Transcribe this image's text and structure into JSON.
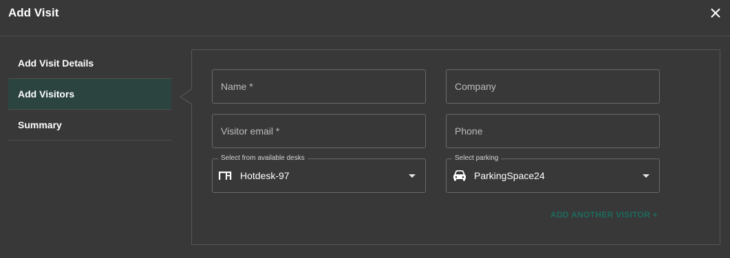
{
  "header": {
    "title": "Add Visit",
    "close_icon": "close-icon"
  },
  "sidebar": {
    "items": [
      {
        "label": "Add Visit Details",
        "active": false
      },
      {
        "label": "Add Visitors",
        "active": true
      },
      {
        "label": "Summary",
        "active": false
      }
    ]
  },
  "form": {
    "name": {
      "placeholder": "Name *"
    },
    "company": {
      "placeholder": "Company"
    },
    "visitor_email": {
      "placeholder": "Visitor email *"
    },
    "phone": {
      "placeholder": "Phone"
    },
    "desk": {
      "legend": "Select from available desks",
      "value": "Hotdesk-97",
      "icon": "desk-icon"
    },
    "parking": {
      "legend": "Select parking",
      "value": "ParkingSpace24",
      "icon": "car-icon"
    },
    "add_another_label": "ADD ANOTHER VISITOR +"
  },
  "colors": {
    "background": "#383838",
    "active_nav": "#2b4440",
    "accent": "#1d6a5e",
    "border": "#6a6a6a"
  }
}
